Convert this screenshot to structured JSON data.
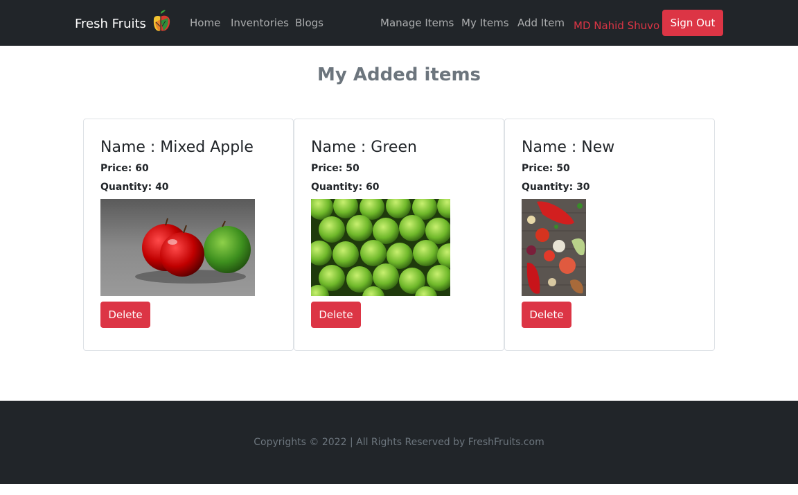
{
  "nav": {
    "brand": "Fresh Fruits",
    "brand_logo_icon": "fruit-logo-icon",
    "links_left": [
      "Home",
      "Inventories",
      "Blogs"
    ],
    "links_right": [
      "Manage Items",
      "My Items",
      "Add Item"
    ],
    "user_name": "MD Nahid Shuvo",
    "signout_label": "Sign Out"
  },
  "page": {
    "title": "My Added items"
  },
  "items": [
    {
      "name": "Name : Mixed Apple",
      "price": "Price: 60",
      "quantity": "Quantity: 40",
      "image": "mixed-apples-photo",
      "delete_label": "Delete"
    },
    {
      "name": "Name : Green",
      "price": "Price: 50",
      "quantity": "Quantity: 60",
      "image": "green-apples-photo",
      "delete_label": "Delete"
    },
    {
      "name": "Name : New",
      "price": "Price: 50",
      "quantity": "Quantity: 30",
      "image": "vegetables-photo",
      "delete_label": "Delete"
    }
  ],
  "footer": {
    "text": "Copyrights © 2022 | All Rights Reserved by FreshFruits.com"
  },
  "colors": {
    "navbar_bg": "#212529",
    "danger": "#dc3545",
    "muted": "#6c757d"
  }
}
